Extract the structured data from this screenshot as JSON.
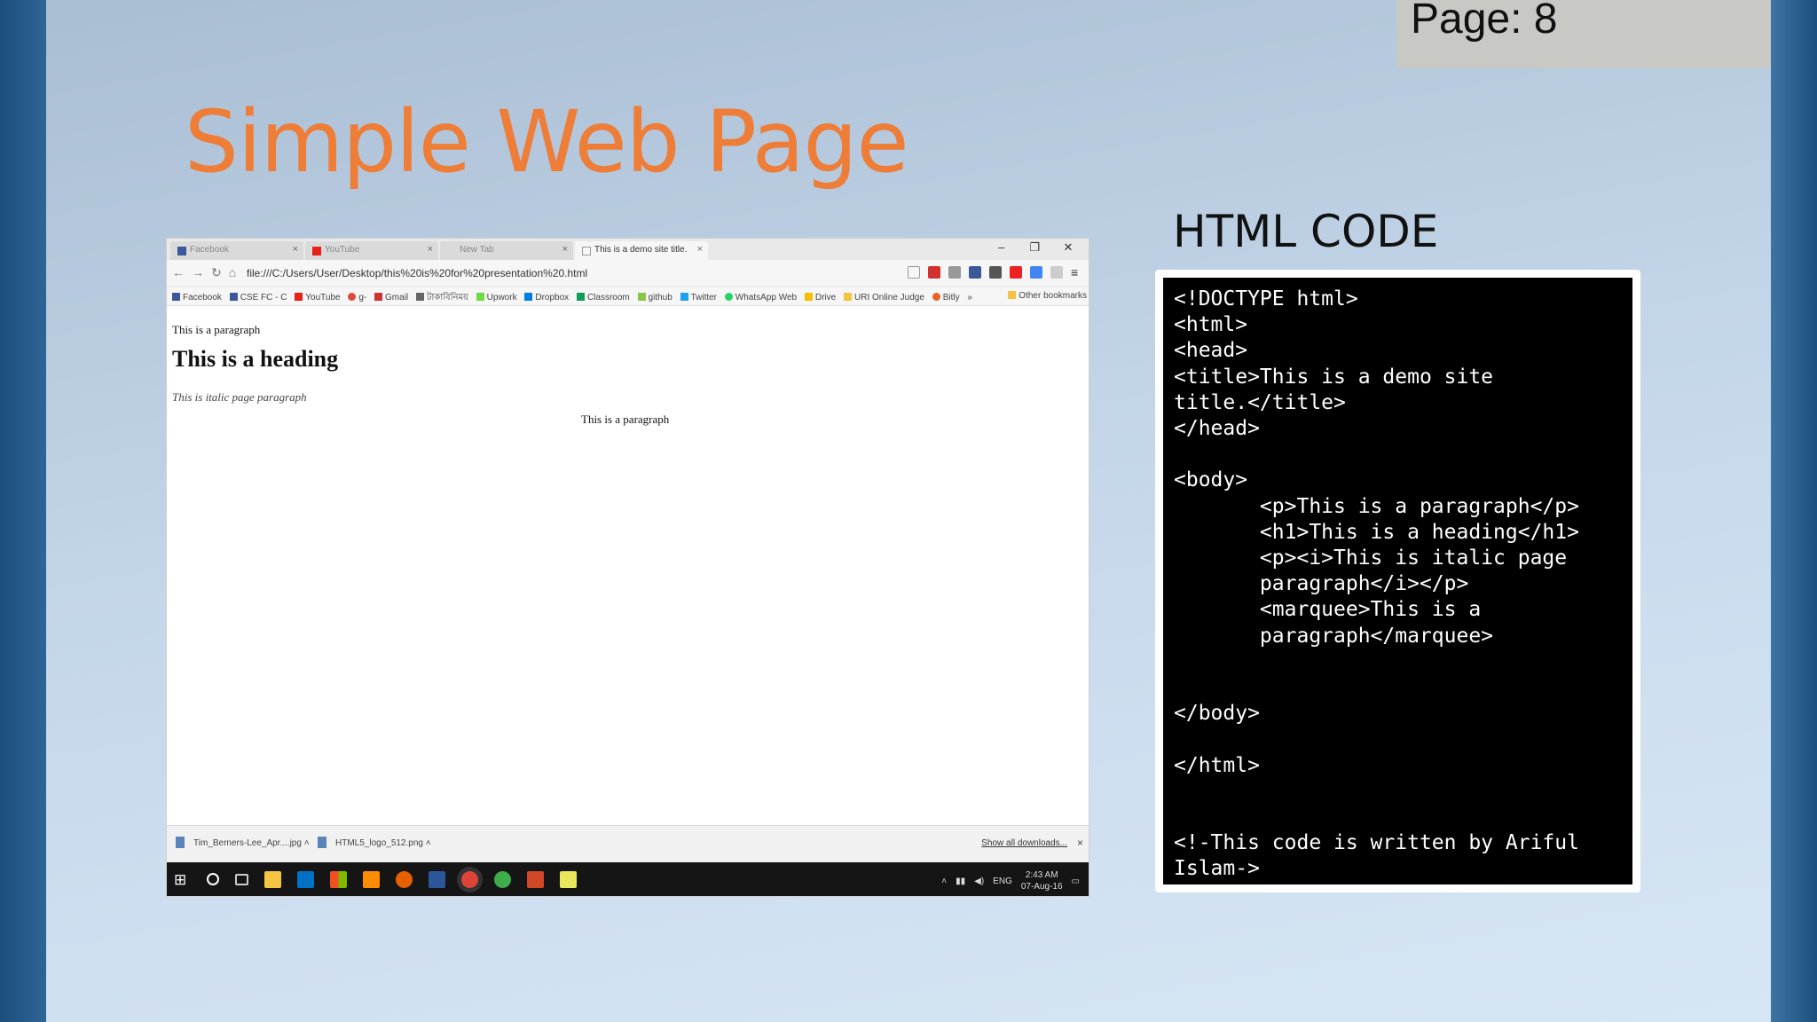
{
  "slide": {
    "page_label": "Page: 8",
    "title": "Simple Web Page",
    "code_heading": "HTML CODE"
  },
  "browser": {
    "tabs": [
      {
        "label": "Facebook",
        "active": false
      },
      {
        "label": "YouTube",
        "active": false
      },
      {
        "label": "New Tab",
        "active": false
      },
      {
        "label": "This is a demo site title.",
        "active": true
      }
    ],
    "window_buttons": {
      "minimize": "–",
      "restore": "❐",
      "close": "✕"
    },
    "address": "file:///C:/Users/User/Desktop/this%20is%20for%20presentation%20.html",
    "bookmarks": [
      "Facebook",
      "CSE FC - C",
      "YouTube",
      "g-",
      "Gmail",
      "টাকাবিনিময়",
      "Upwork",
      "Dropbox",
      "Classroom",
      "github",
      "Twitter",
      "WhatsApp Web",
      "Drive",
      "URI Online Judge",
      "Bitly",
      "»"
    ],
    "other_bookmarks": "Other bookmarks",
    "page": {
      "paragraph": "This is a paragraph",
      "heading": "This is a heading",
      "italic": "This is italic page paragraph",
      "marquee": "This is a paragraph"
    },
    "downloads": [
      "Tim_Berners-Lee_Apr....jpg",
      "HTML5_logo_512.png"
    ],
    "show_all": "Show all downloads...",
    "tray": {
      "lang": "ENG",
      "time": "2:43 AM",
      "date": "07-Aug-16"
    }
  },
  "code_lines": "<!DOCTYPE html>\n<html>\n<head>\n<title>This is a demo site\ntitle.</title>\n</head>\n\n<body>\n       <p>This is a paragraph</p>\n       <h1>This is a heading</h1>\n       <p><i>This is italic page\n       paragraph</i></p>\n       <marquee>This is a\n       paragraph</marquee>\n\n\n</body>\n\n</html>\n\n\n<!-This code is written by Ariful\nIslam->"
}
